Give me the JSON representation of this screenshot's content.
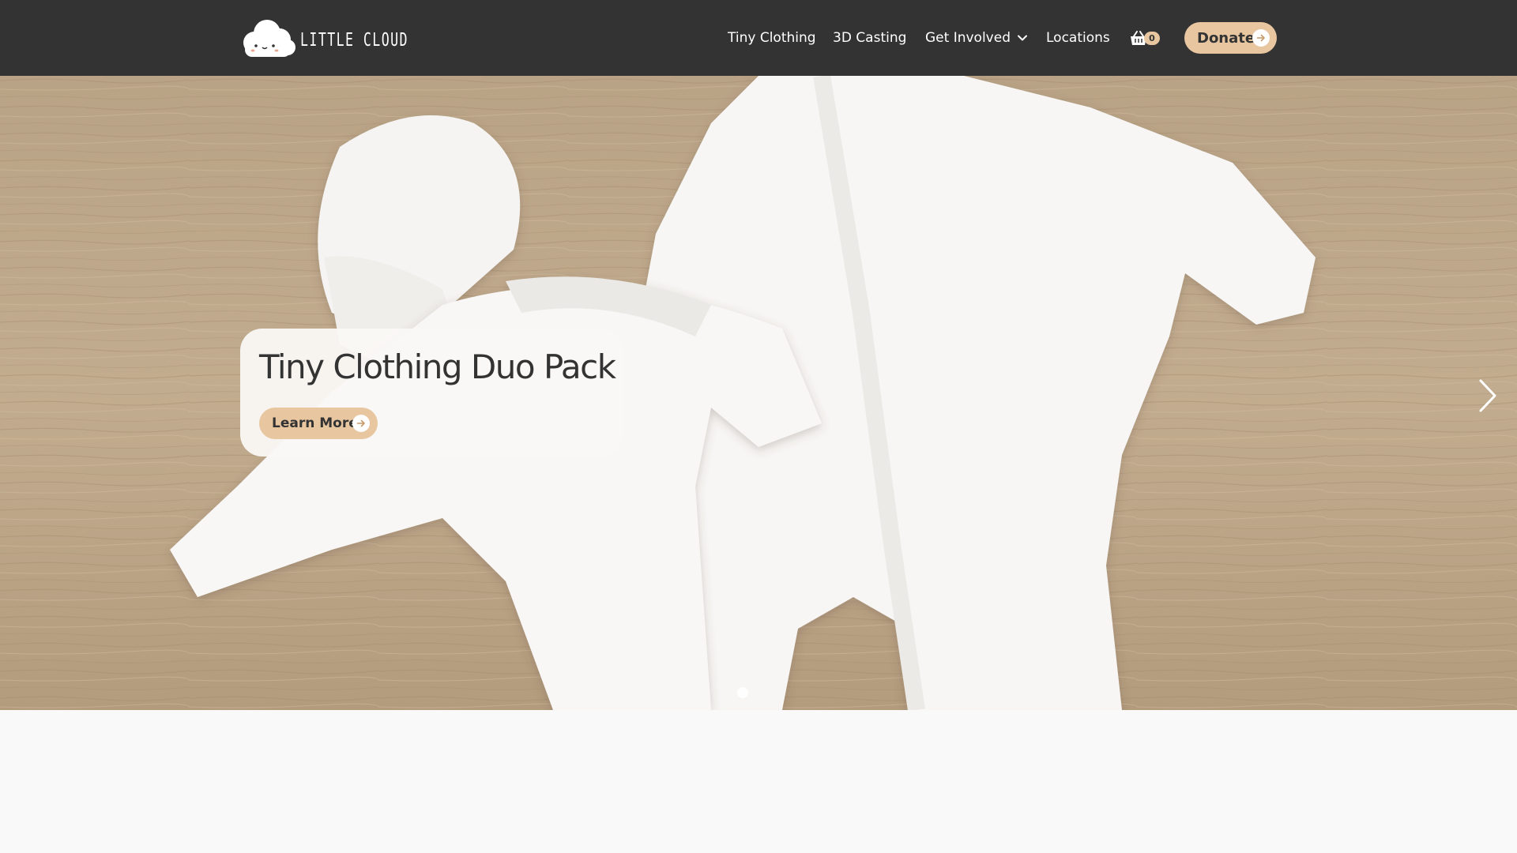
{
  "brand": {
    "name": "LITTLE CLOUD"
  },
  "nav": {
    "items": [
      {
        "label": "Tiny Clothing"
      },
      {
        "label": "3D Casting"
      },
      {
        "label": "Get Involved",
        "has_dropdown": true
      },
      {
        "label": "Locations"
      }
    ],
    "basket": {
      "icon": "basket-icon",
      "count": "0"
    },
    "donate": {
      "label": "Donate",
      "icon": "arrow-right-icon"
    }
  },
  "hero": {
    "slide_title": "Tiny Clothing Duo Pack",
    "cta_label": "Learn More",
    "next_icon": "chevron-right-icon",
    "slide_count_visible": 1,
    "active_slide": 1
  },
  "colors": {
    "header_bg": "#333333",
    "accent": "#e8c6a0",
    "text_dark": "#333333",
    "page_bg": "#f9f9f9"
  }
}
